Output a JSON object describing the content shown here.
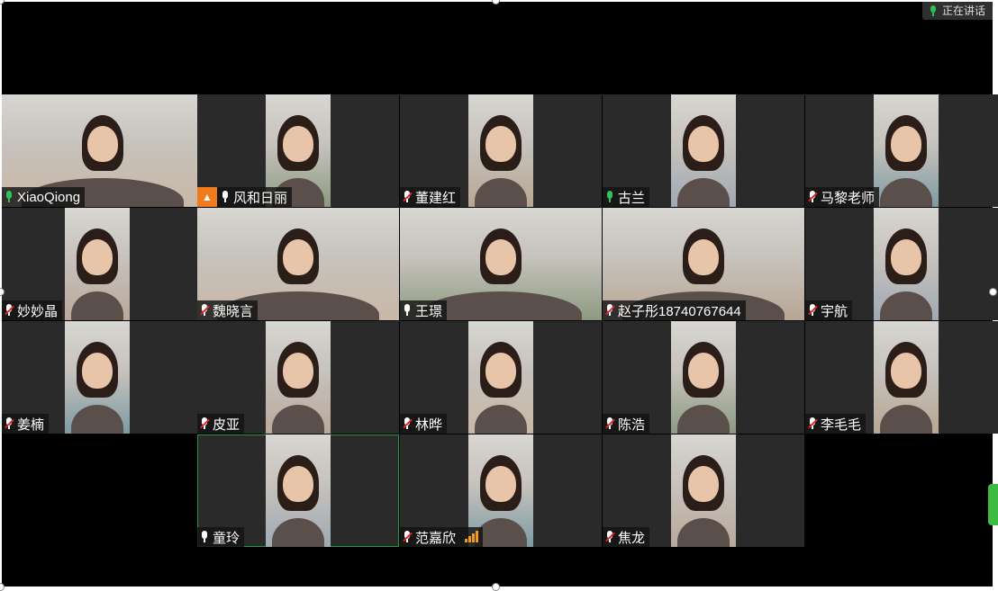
{
  "speaking_indicator": {
    "label": "正在讲话",
    "icon": "mic-icon"
  },
  "colors": {
    "stage": "#000000",
    "tile": "#2a2a2a",
    "active_border": "#1f9a3c",
    "muted_slash": "#e0262c",
    "signal": "#f39a1b",
    "host_badge": "#f07b1d"
  },
  "participants": [
    {
      "name": "XiaoQiong",
      "mic": "active"
    },
    {
      "name": "风和日丽",
      "mic": "on",
      "badge": "host-avatar-icon"
    },
    {
      "name": "董建红",
      "mic": "muted"
    },
    {
      "name": "古兰",
      "mic": "active"
    },
    {
      "name": "马黎老师",
      "mic": "muted"
    },
    {
      "name": "妙妙晶",
      "mic": "muted"
    },
    {
      "name": "魏晓言",
      "mic": "muted"
    },
    {
      "name": "王璟",
      "mic": "on"
    },
    {
      "name": "赵子彤18740767644",
      "mic": "muted"
    },
    {
      "name": "宇航",
      "mic": "muted"
    },
    {
      "name": "姜楠",
      "mic": "muted"
    },
    {
      "name": "皮亚",
      "mic": "muted"
    },
    {
      "name": "林晔",
      "mic": "muted"
    },
    {
      "name": "陈浩",
      "mic": "muted"
    },
    {
      "name": "李毛毛",
      "mic": "muted"
    },
    {
      "name": "童玲",
      "mic": "on",
      "active": true
    },
    {
      "name": "范嘉欣",
      "mic": "muted",
      "signal": "signal-bars-icon"
    },
    {
      "name": "焦龙",
      "mic": "muted"
    }
  ]
}
